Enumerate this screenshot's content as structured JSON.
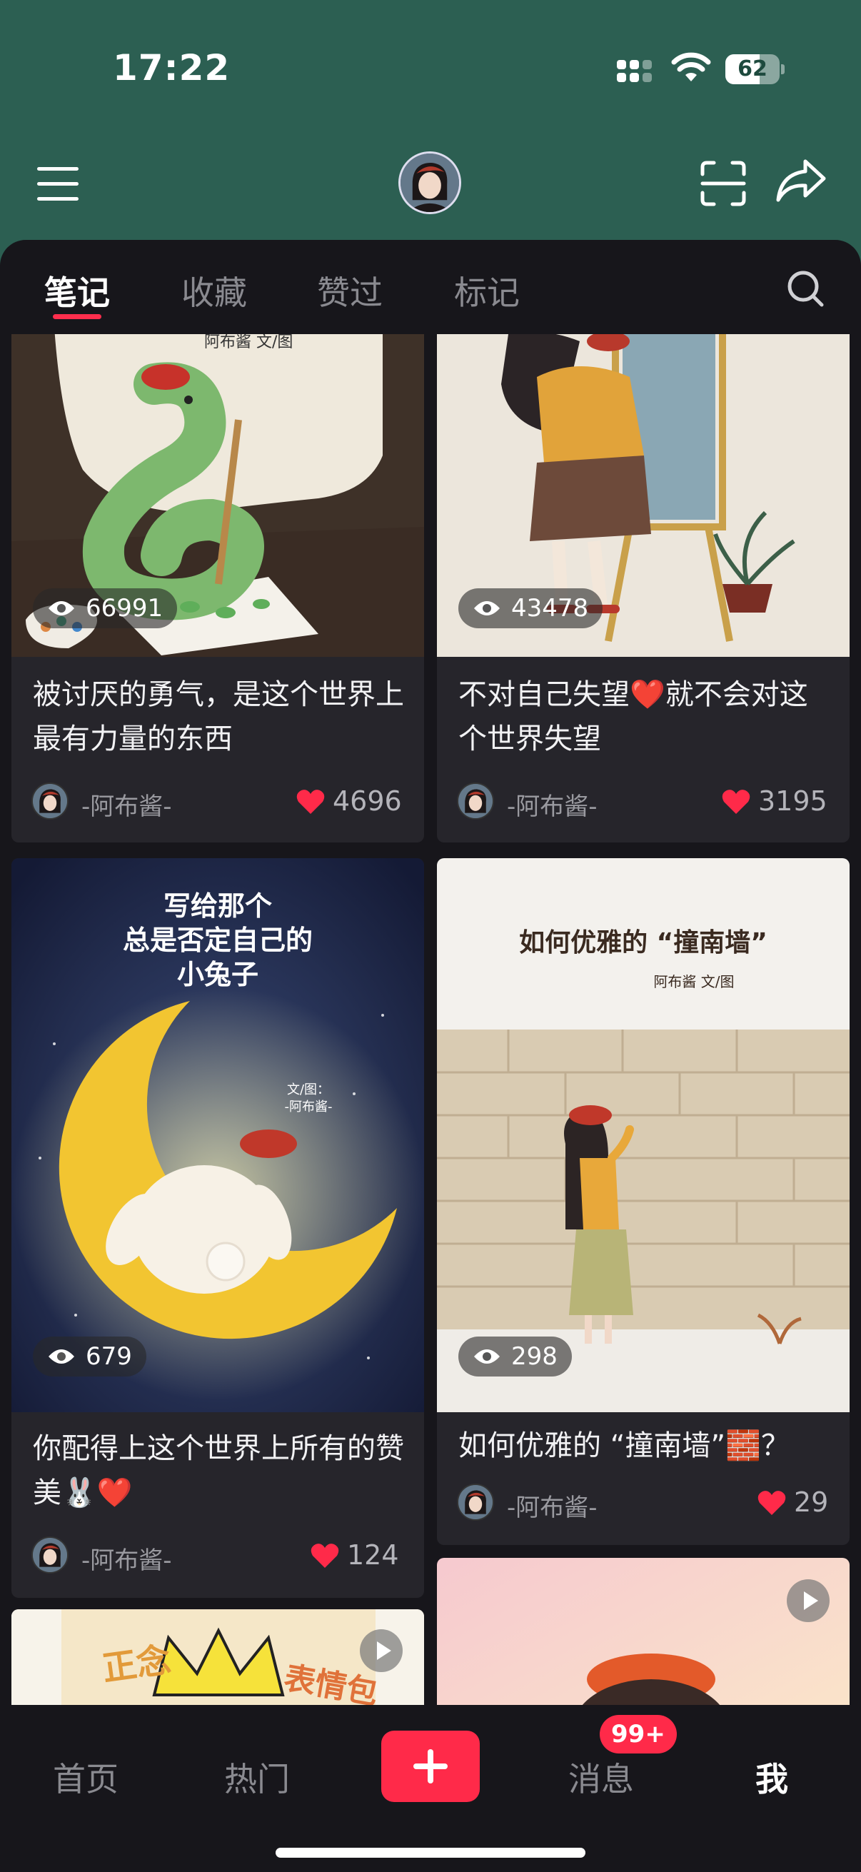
{
  "status": {
    "time": "17:22",
    "battery": "62"
  },
  "tabs": [
    {
      "label": "笔记",
      "active": true
    },
    {
      "label": "收藏"
    },
    {
      "label": "赞过"
    },
    {
      "label": "标记"
    }
  ],
  "cards": [
    {
      "views": "66991",
      "title": "被讨厌的勇气，是这个世界上最有力量的东西",
      "author": "-阿布酱-",
      "likes": "4696",
      "img_caption": "阿布酱 文/图"
    },
    {
      "views": "43478",
      "title": "不对自己失望❤️就不会对这个世界失望",
      "author": "-阿布酱-",
      "likes": "3195"
    },
    {
      "views": "679",
      "title": "你配得上这个世界上所有的赞美🐰❤️",
      "author": "-阿布酱-",
      "likes": "124",
      "img_text": "写给那个\n总是否定自己的\n小兔子",
      "img_caption": "文/图：\n-阿布酱-"
    },
    {
      "views": "298",
      "title": "如何优雅的 “撞南墙”🧱？",
      "author": "-阿布酱-",
      "likes": "29",
      "img_text": "如何优雅的 “撞南墙”",
      "img_caption": "阿布酱 文/图"
    },
    {
      "img_text": "正念 表情包"
    },
    {}
  ],
  "bottom_nav": {
    "home": "首页",
    "hot": "热门",
    "messages": "消息",
    "messages_badge": "99+",
    "me": "我"
  },
  "colors": {
    "header_bg": "#2c5f52",
    "sheet_bg": "#17161b",
    "card_bg": "#26252b",
    "accent": "#ff2a49"
  }
}
